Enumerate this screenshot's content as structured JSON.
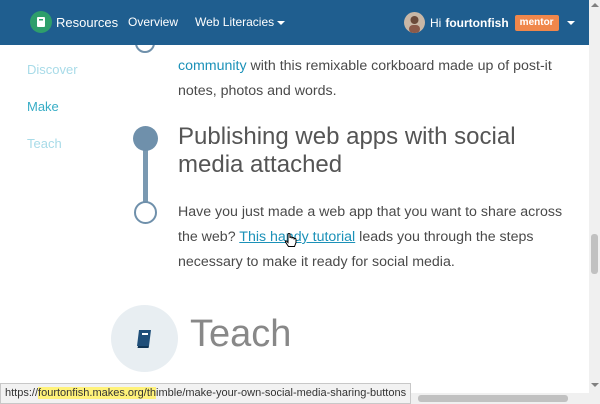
{
  "navbar": {
    "brand_label": "Resources",
    "links": [
      {
        "label": "Overview"
      },
      {
        "label": "Web Literacies"
      }
    ],
    "user": {
      "greeting": "Hi",
      "username": "fourtonfish",
      "badge": "mentor"
    }
  },
  "sidebar": {
    "items": [
      {
        "label": "Discover",
        "active": false
      },
      {
        "label": "Make",
        "active": true
      },
      {
        "label": "Teach",
        "active": false
      }
    ]
  },
  "content": {
    "previous_para": {
      "link_text": "community",
      "text": " with this remixable corkboard made up of post-it notes, photos and words."
    },
    "section": {
      "title": "Publishing web apps with social media attached",
      "para_before": "Have you just made a web app that you want to share across the web? ",
      "link_text": "This handy tutorial",
      "para_after": " leads you through the steps necessary to make it ready for social media."
    },
    "teach_heading": "Teach"
  },
  "statusbar": {
    "url_prefix": "https://",
    "url_highlight": "fourtonfish.makes.org/th",
    "url_rest": "imble/make-your-own-social-media-sharing-buttons"
  },
  "colors": {
    "navbar_bg": "#1f5e8f",
    "badge_bg": "#f0874b",
    "link": "#1b91b8",
    "timeline": "#6f90ab"
  }
}
